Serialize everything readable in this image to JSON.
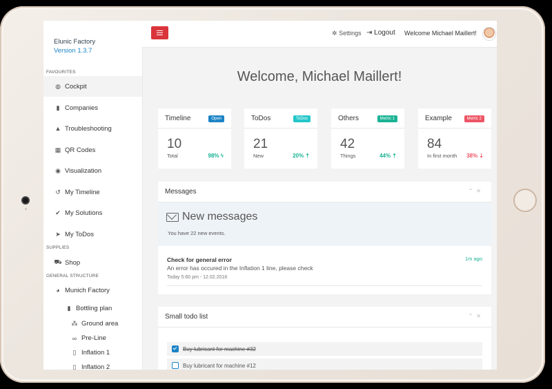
{
  "app": {
    "name": "Elunic Factory",
    "version": "Version 1.3.7"
  },
  "sidebar": {
    "sections": {
      "favourites": "FAVOURITES",
      "supplies": "SUPPLIES",
      "general": "GENERAL STRUCTURE"
    },
    "items": [
      {
        "label": "Cockpit",
        "icon": "dashboard-icon"
      },
      {
        "label": "Companies",
        "icon": "building-icon"
      },
      {
        "label": "Troubleshooting",
        "icon": "warning-icon"
      },
      {
        "label": "QR Codes",
        "icon": "qrcode-icon"
      },
      {
        "label": "Visualization",
        "icon": "eye-icon"
      },
      {
        "label": "My Timeline",
        "icon": "history-icon"
      },
      {
        "label": "My Solutions",
        "icon": "check-icon"
      },
      {
        "label": "My ToDos",
        "icon": "send-icon"
      }
    ],
    "shop": "Shop",
    "tree": {
      "factory": "Munich Factory",
      "plant": "Bottling plan",
      "children": [
        "Ground area",
        "Pre-Line",
        "Inflation 1",
        "Inflation 2"
      ]
    }
  },
  "topbar": {
    "settings": "Settings",
    "logout": "Logout",
    "welcome": "Welcome Michael Maillert!"
  },
  "welcome_heading": "Welcome, Michael Maillert!",
  "stats": [
    {
      "title": "Timeline",
      "badge": "Open",
      "badge_color": "#1c84c6",
      "value": "10",
      "label": "Total",
      "pct": "98% ϟ",
      "pct_color": "#1ab394"
    },
    {
      "title": "ToDos",
      "badge": "ToDos",
      "badge_color": "#23c6c8",
      "value": "21",
      "label": "New",
      "pct": "20% ⇡",
      "pct_color": "#1ab394"
    },
    {
      "title": "Others",
      "badge": "Metric 1",
      "badge_color": "#1ab394",
      "value": "42",
      "label": "Things",
      "pct": "44% ⇡",
      "pct_color": "#1ab394"
    },
    {
      "title": "Example",
      "badge": "Metric 2",
      "badge_color": "#ed5565",
      "value": "84",
      "label": "In first month",
      "pct": "38% ⇣",
      "pct_color": "#ed5565"
    }
  ],
  "messages": {
    "title": "Messages",
    "heading": "New messages",
    "subtext": "You have 22 new events.",
    "item": {
      "title": "Check for general error",
      "body": "An error has occured in the Inflation 1 line, please check",
      "time": "Today 5:60 pm - 12.02.2018",
      "ago": "1m ago"
    }
  },
  "todo": {
    "title": "Small todo list",
    "items": [
      {
        "label": "Buy lubricant for machine #32",
        "done": true
      },
      {
        "label": "Buy lubricant for machine #12",
        "done": false
      }
    ]
  },
  "colors": {
    "accent": "#1c84c6",
    "danger": "#d9353b",
    "success": "#1ab394"
  }
}
